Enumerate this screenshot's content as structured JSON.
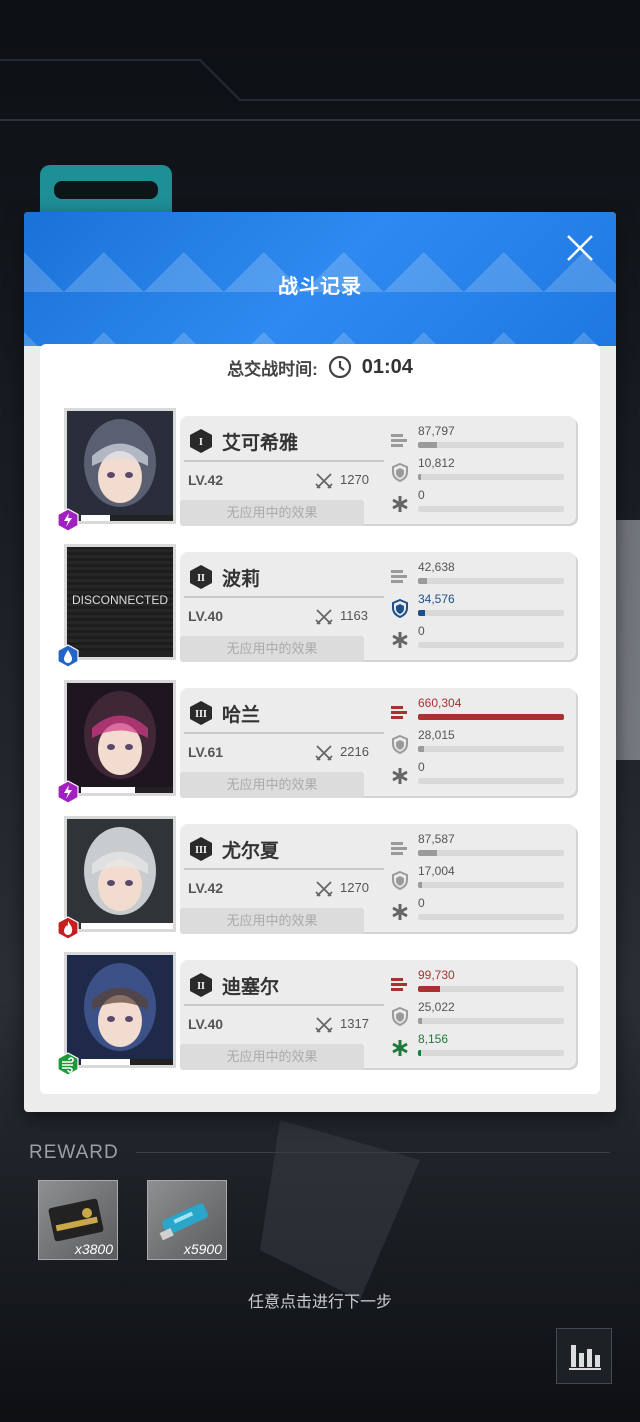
{
  "dialog": {
    "title": "战斗记录",
    "time_label": "总交战时间:",
    "time_value": "01:04"
  },
  "records": [
    {
      "rank": "I",
      "name": "艾可希雅",
      "level": "LV.42",
      "power": "1270",
      "effect": "无应用中的效果",
      "element": "electric",
      "element_color": "#a020c0",
      "hp_fraction": 0.3,
      "damage": "87,797",
      "damage_fraction": 0.13,
      "tank": "10,812",
      "tank_fraction": 0.02,
      "heal": "0",
      "heal_fraction": 0
    },
    {
      "rank": "II",
      "name": "波莉",
      "level": "LV.40",
      "power": "1163",
      "effect": "无应用中的效果",
      "element": "water",
      "element_color": "#2264c8",
      "hp_fraction": 0.0,
      "portrait_text": "DISCONNECTED",
      "damage": "42,638",
      "damage_fraction": 0.06,
      "tank": "34,576",
      "tank_fraction": 0.05,
      "heal": "0",
      "heal_fraction": 0
    },
    {
      "rank": "III",
      "name": "哈兰",
      "level": "LV.61",
      "power": "2216",
      "effect": "无应用中的效果",
      "element": "electric",
      "element_color": "#a020c0",
      "hp_fraction": 0.55,
      "damage": "660,304",
      "damage_fraction": 1.0,
      "tank": "28,015",
      "tank_fraction": 0.04,
      "heal": "0",
      "heal_fraction": 0
    },
    {
      "rank": "III",
      "name": "尤尔夏",
      "level": "LV.42",
      "power": "1270",
      "effect": "无应用中的效果",
      "element": "fire",
      "element_color": "#c81e1e",
      "hp_fraction": 1.0,
      "damage": "87,587",
      "damage_fraction": 0.13,
      "tank": "17,004",
      "tank_fraction": 0.03,
      "heal": "0",
      "heal_fraction": 0
    },
    {
      "rank": "II",
      "name": "迪塞尔",
      "level": "LV.40",
      "power": "1317",
      "effect": "无应用中的效果",
      "element": "wind",
      "element_color": "#1e9a3c",
      "hp_fraction": 0.5,
      "damage": "99,730",
      "damage_fraction": 0.15,
      "tank": "25,022",
      "tank_fraction": 0.03,
      "heal": "8,156",
      "heal_fraction": 0.02
    }
  ],
  "reward": {
    "label": "REWARD",
    "items": [
      {
        "icon": "credit-card-icon",
        "qty": "x3800"
      },
      {
        "icon": "usb-drive-icon",
        "qty": "x5900"
      }
    ]
  },
  "hint": "任意点击进行下一步",
  "colors": {
    "damage_highlight": "#a83232",
    "tank_highlight": "#1e4f8a",
    "heal_highlight": "#1e7a3c",
    "default_bar": "#9a9a9a"
  }
}
